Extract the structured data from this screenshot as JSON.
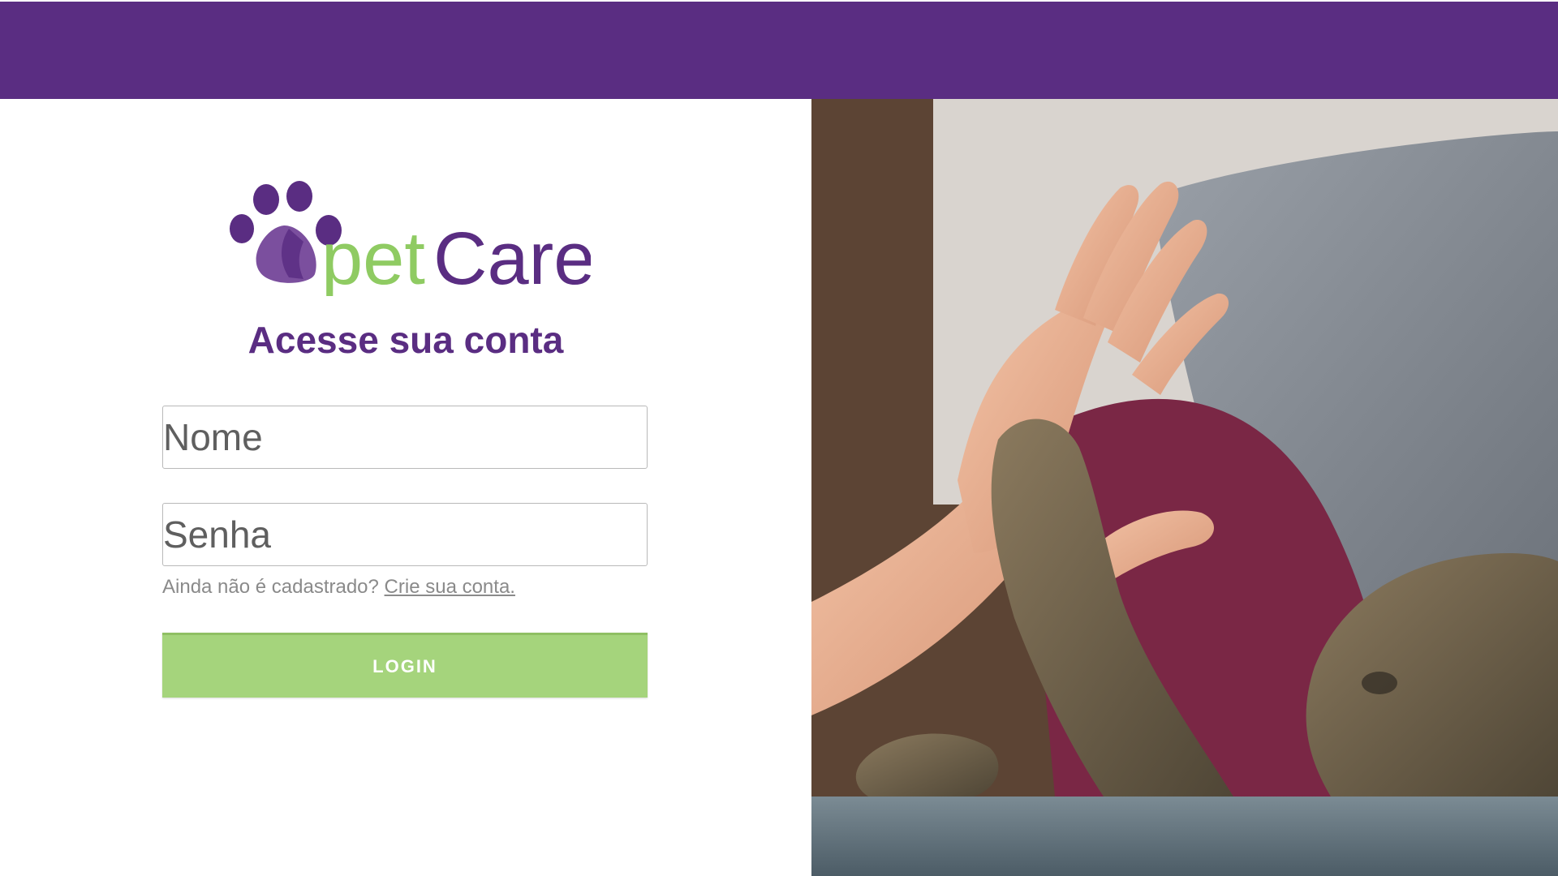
{
  "brand": {
    "logo_text_part1": "pet",
    "logo_text_part2": "Care",
    "colors": {
      "purple": "#5a2d82",
      "green": "#8fcb62"
    }
  },
  "login": {
    "title": "Acesse sua conta",
    "name_placeholder": "Nome",
    "password_placeholder": "Senha",
    "signup_prompt": "Ainda não é cadastrado?",
    "signup_link": "Crie sua conta.",
    "login_button": "LOGIN"
  },
  "photo": {
    "icon": "hand-cat-paw-high-five-photo"
  }
}
